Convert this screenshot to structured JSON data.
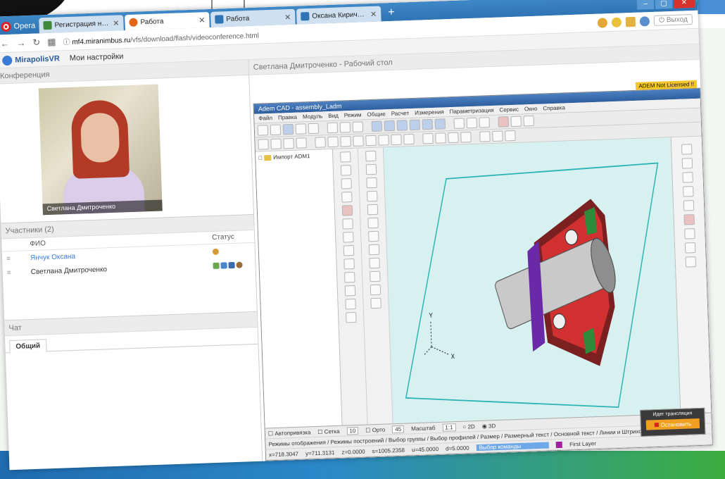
{
  "browser": {
    "opera_label": "Opera",
    "tabs": [
      {
        "label": "Регистрация на онлайн-ко",
        "icon_color": "#3f8a3a",
        "active": false
      },
      {
        "label": "Работа",
        "icon_color": "#e0661a",
        "active": true
      },
      {
        "label": "Работа",
        "icon_color": "#2f74b4",
        "active": false
      },
      {
        "label": "Оксана Кириченко",
        "icon_color": "#2f74b4",
        "active": false
      }
    ],
    "new_tab_symbol": "+",
    "url_host": "mf4.miranimbus.ru",
    "url_path": "/vfs/download/flash/videoconference.html",
    "logout_label": "Выход"
  },
  "app": {
    "brand": "MirapolisVR",
    "settings_link": "Мои настройки"
  },
  "conference": {
    "title": "Конференция",
    "video_caption": "Светлана Дмитроченко"
  },
  "participants": {
    "title": "Участники (2)",
    "col_name": "ФИО",
    "col_status": "Статус",
    "rows": [
      {
        "name": "Янчук Оксана",
        "color": "#3a7bd5"
      },
      {
        "name": "Светлана Дмитроченко",
        "color": "#333333"
      }
    ]
  },
  "chat": {
    "title": "Чат",
    "tab": "Общий"
  },
  "desktop": {
    "title": "Светлана Дмитроченко - Рабочий стол"
  },
  "cad": {
    "window_title": "Adem CAD - assembly_Ladm",
    "licence_badge": "ADEM Not Licensed !!",
    "menu": [
      "Файл",
      "Правка",
      "Модуль",
      "Вид",
      "Режим",
      "Общие",
      "Расчет",
      "Измерения",
      "Параметризация",
      "Сервис",
      "Окно",
      "Справка"
    ],
    "tree_item": "Импорт ADM1",
    "status_row1": {
      "snap": "Автопривязка",
      "grid": "Сетка",
      "grid_val": "10",
      "ortho": "Орто",
      "ortho_val": "45",
      "scale": "Масштаб",
      "scale_val": "1:1",
      "mode2d": "2D",
      "mode3d": "3D"
    },
    "status_tabs": "Режимы отображения / Режимы построений / Выбор группы / Выбор профилей / Размер / Размерный текст / Основной текст / Линии и Штриховки / Слои /",
    "coords": {
      "x": "x=718.3047",
      "y": "y=711.3131",
      "z": "z=0.0000",
      "s": "s=1005.2358",
      "u": "u=45.0000",
      "d": "d=5.0000"
    },
    "command_hint": "Выбор команды",
    "layer": "First Layer",
    "axis_y": "Y",
    "axis_x": "X"
  },
  "broadcast": {
    "title": "Идет трансляция",
    "stop_label": "Остановить"
  }
}
